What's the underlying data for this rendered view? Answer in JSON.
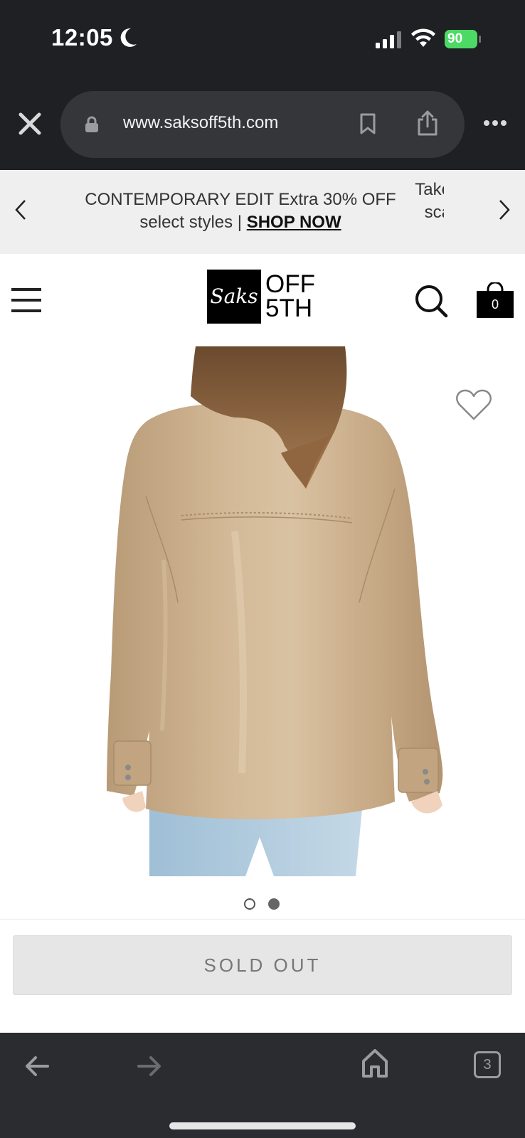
{
  "status_bar": {
    "time": "12:05",
    "battery": "90"
  },
  "browser": {
    "url": "www.saksoff5th.com",
    "tab_count": "3"
  },
  "promo": {
    "text_line1": "CONTEMPORARY EDIT Extra 30% OFF",
    "text_line2_prefix": "select styles | ",
    "cta": "SHOP NOW",
    "next_text_line1": "Take",
    "next_text_line2": "sca"
  },
  "header": {
    "logo_script": "Saks",
    "logo_line1": "OFF",
    "logo_line2": "5TH",
    "bag_count": "0"
  },
  "product": {
    "image_index": 2,
    "image_count": 2,
    "jacket_color": "#c9ad8a"
  },
  "buy": {
    "button_label": "SOLD OUT"
  },
  "icons": [
    "close-icon",
    "lock-icon",
    "bookmark-icon",
    "share-icon",
    "more-icon",
    "chevron-left-icon",
    "chevron-right-icon",
    "hamburger-icon",
    "search-icon",
    "shopping-bag-icon",
    "heart-icon",
    "back-arrow-icon",
    "forward-arrow-icon",
    "home-icon",
    "tabs-icon"
  ]
}
